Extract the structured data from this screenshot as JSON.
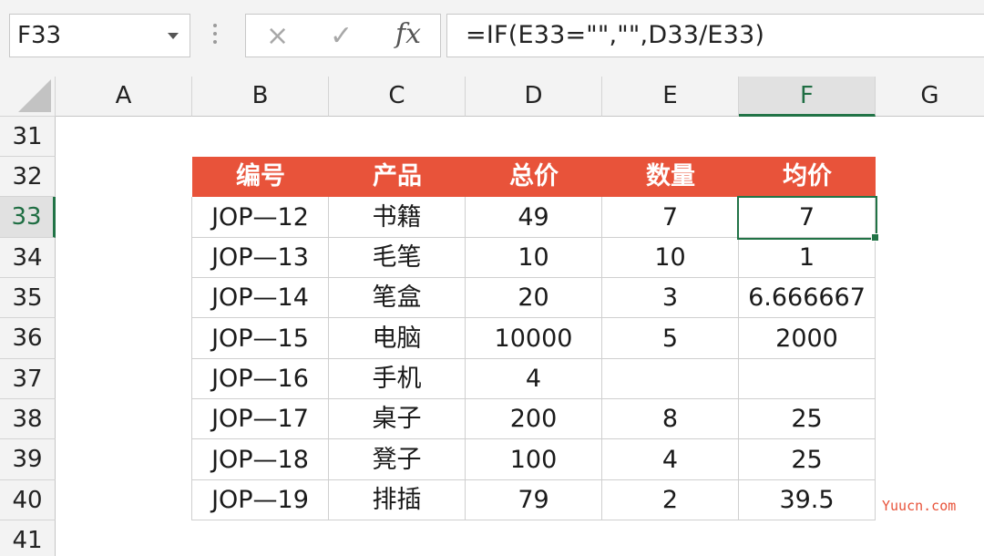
{
  "name_box": "F33",
  "formula_bar": {
    "cancel_icon": "×",
    "enter_icon": "✓",
    "fx_label": "fx",
    "formula": "=IF(E33=\"\",\"\",D33/E33)"
  },
  "columns": [
    "A",
    "B",
    "C",
    "D",
    "E",
    "F",
    "G"
  ],
  "selected_column": "F",
  "rows": [
    "31",
    "32",
    "33",
    "34",
    "35",
    "36",
    "37",
    "38",
    "39",
    "40",
    "41"
  ],
  "selected_row": "33",
  "table": {
    "headers": [
      "编号",
      "产品",
      "总价",
      "数量",
      "均价"
    ],
    "rows": [
      [
        "JOP—12",
        "书籍",
        "49",
        "7",
        "7"
      ],
      [
        "JOP—13",
        "毛笔",
        "10",
        "10",
        "1"
      ],
      [
        "JOP—14",
        "笔盒",
        "20",
        "3",
        "6.666667"
      ],
      [
        "JOP—15",
        "电脑",
        "10000",
        "5",
        "2000"
      ],
      [
        "JOP—16",
        "手机",
        "4",
        "",
        ""
      ],
      [
        "JOP—17",
        "桌子",
        "200",
        "8",
        "25"
      ],
      [
        "JOP—18",
        "凳子",
        "100",
        "4",
        "25"
      ],
      [
        "JOP—19",
        "排插",
        "79",
        "2",
        "39.5"
      ]
    ]
  },
  "watermark": "Yuucn.com",
  "colors": {
    "header_fill": "#e8533a",
    "selection": "#217346"
  }
}
